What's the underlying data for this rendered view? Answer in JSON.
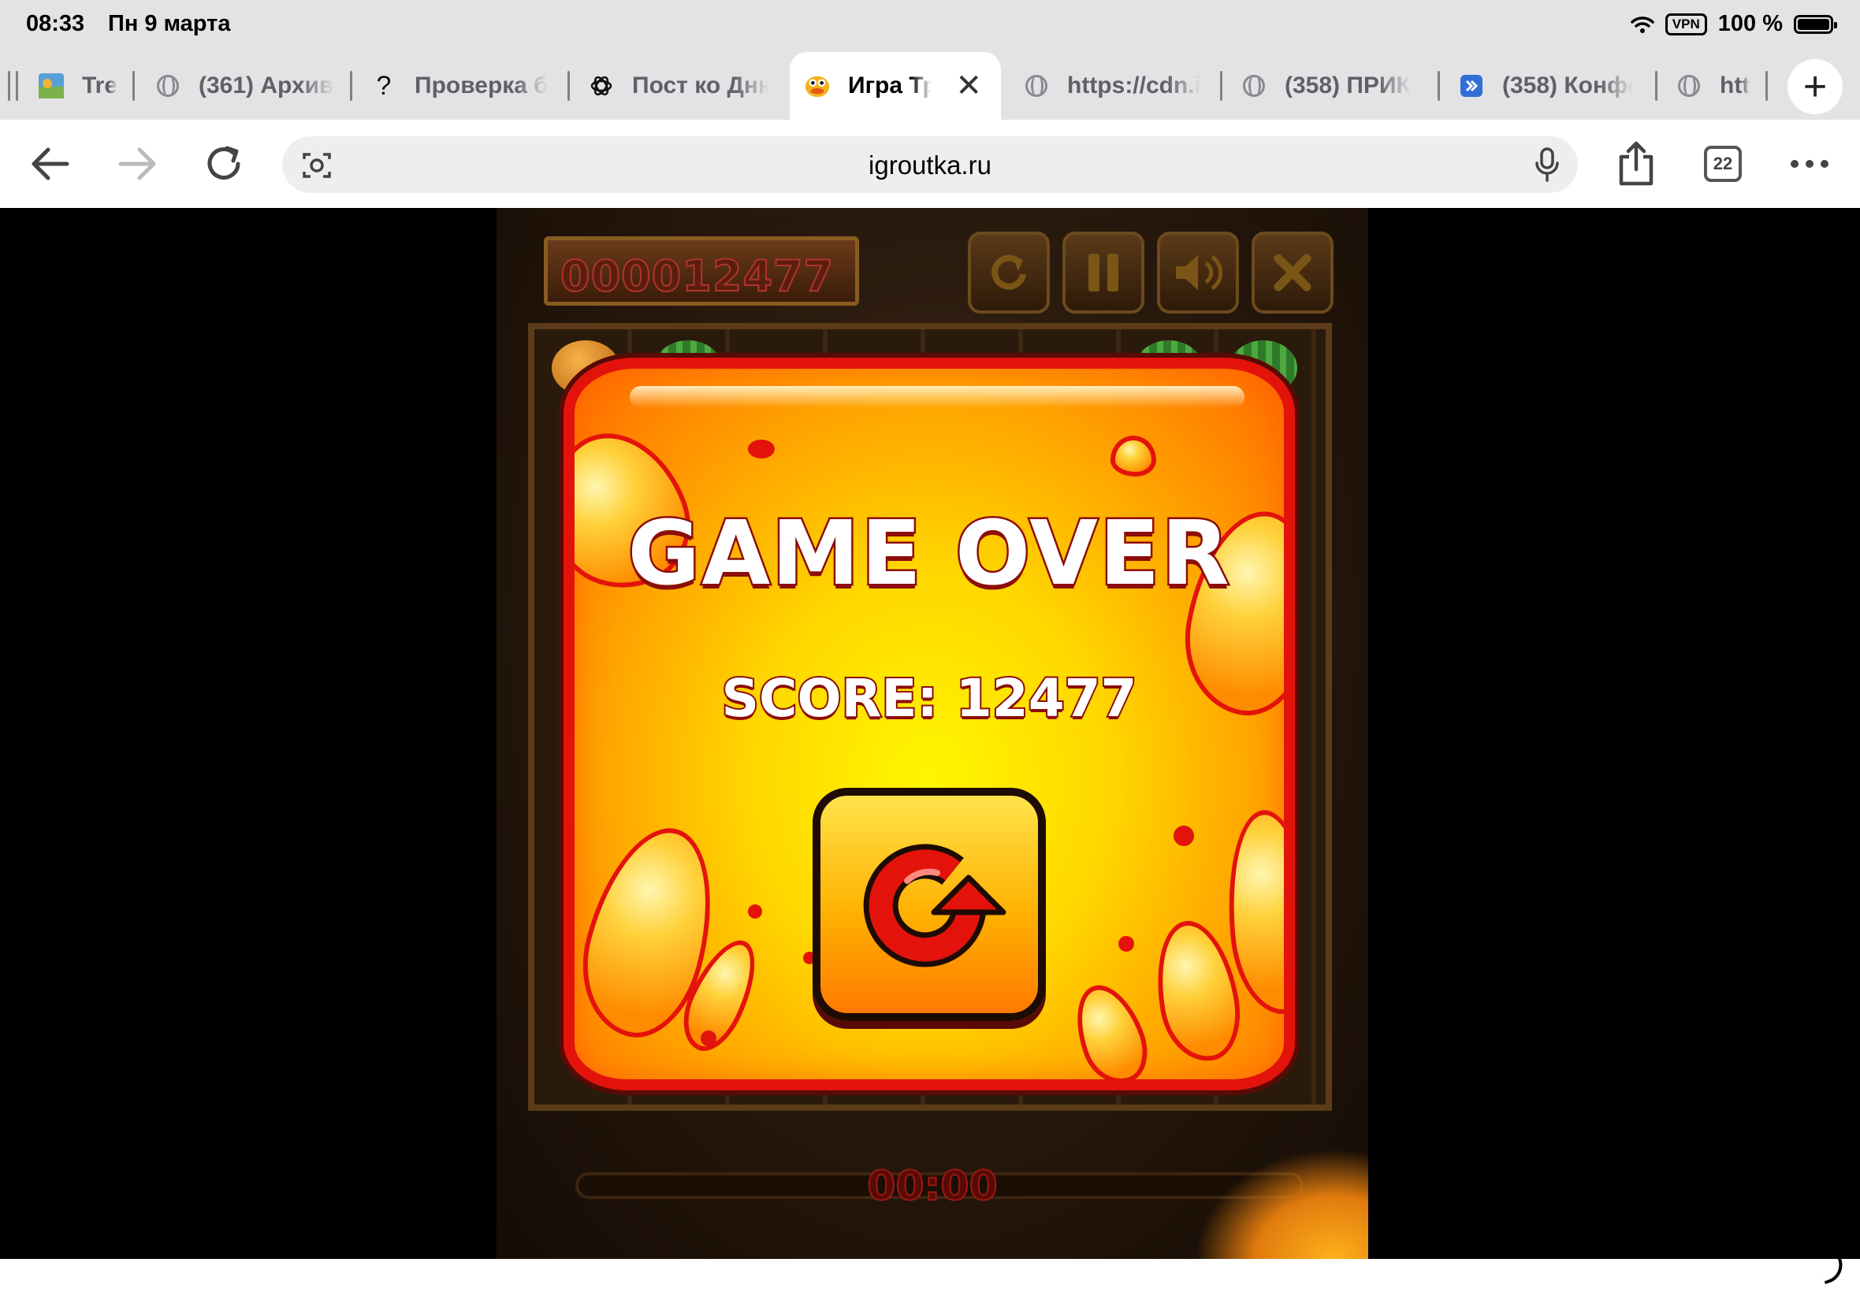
{
  "status": {
    "time": "08:33",
    "date": "Пн 9 марта",
    "vpn": "VPN",
    "battery_percent": "100 %"
  },
  "tabs": [
    {
      "label": "Tre",
      "icon": "game-favicon"
    },
    {
      "label": "(361) Архив",
      "icon": "globe-icon"
    },
    {
      "label": "Проверка б",
      "icon": "question-icon"
    },
    {
      "label": "Пост ко Дню",
      "icon": "openai-icon"
    },
    {
      "label": "Игра Тр",
      "icon": "duck-favicon",
      "active": true
    },
    {
      "label": "https://cdn.i",
      "icon": "globe-icon"
    },
    {
      "label": "(358) ПРИК",
      "icon": "globe-icon"
    },
    {
      "label": "(358) Конфе",
      "icon": "app-favicon"
    },
    {
      "label": "htt",
      "icon": "globe-icon"
    }
  ],
  "toolbar": {
    "url": "igroutka.ru",
    "tab_count": "22"
  },
  "game": {
    "score_counter": "000012477",
    "timer": "00:00",
    "controls": [
      "restart-icon",
      "pause-icon",
      "sound-icon",
      "close-icon"
    ],
    "dialog": {
      "title": "GAME OVER",
      "score_text": "SCORE: 12477"
    }
  },
  "colors": {
    "dialog_border": "#e3130c",
    "dialog_fill": "#ffd800",
    "board_wood": "#3b2712"
  }
}
